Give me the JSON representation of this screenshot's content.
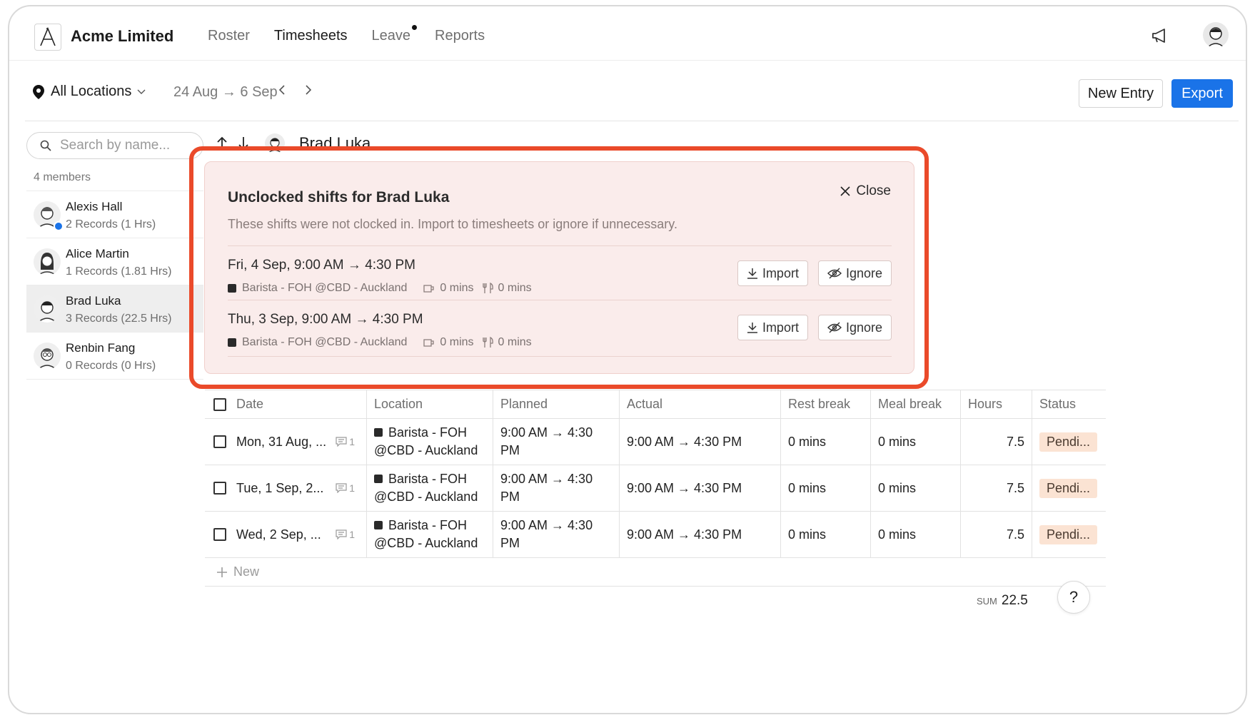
{
  "app": {
    "company": "Acme Limited",
    "nav": [
      {
        "label": "Roster"
      },
      {
        "label": "Timesheets"
      },
      {
        "label": "Leave"
      },
      {
        "label": "Reports"
      }
    ]
  },
  "toolbar": {
    "location_label": "All Locations",
    "date_range": "24 Aug → 6 Sep",
    "prev": "‹",
    "next": "›",
    "new_entry_label": "New Entry",
    "export_label": "Export"
  },
  "sidebar": {
    "search_placeholder": "Search by name...",
    "members_count": "4 members",
    "members": [
      {
        "name": "Alexis Hall",
        "records": "2 Records (1 Hrs)"
      },
      {
        "name": "Alice Martin",
        "records": "1 Records (1.81 Hrs)"
      },
      {
        "name": "Brad Luka",
        "records": "3 Records (22.5 Hrs)"
      },
      {
        "name": "Renbin Fang",
        "records": "0 Records (0 Hrs)"
      }
    ]
  },
  "employee": {
    "name": "Brad Luka"
  },
  "popup": {
    "title": "Unclocked shifts for Brad Luka",
    "subtitle": "These shifts were not clocked in. Import to timesheets or ignore if unnecessary.",
    "close_label": "Close",
    "shifts": [
      {
        "when": "Fri, 4 Sep, 9:00 AM → 4:30 PM",
        "location": "Barista - FOH @CBD - Auckland",
        "rest": "0 mins",
        "meal": "0 mins",
        "import_label": "Import",
        "ignore_label": "Ignore"
      },
      {
        "when": "Thu, 3 Sep, 9:00 AM → 4:30 PM",
        "location": "Barista - FOH @CBD - Auckland",
        "rest": "0 mins",
        "meal": "0 mins",
        "import_label": "Import",
        "ignore_label": "Ignore"
      }
    ]
  },
  "table": {
    "headers": {
      "date": "Date",
      "location": "Location",
      "planned": "Planned",
      "actual": "Actual",
      "rest": "Rest break",
      "meal": "Meal break",
      "hours": "Hours",
      "status": "Status"
    },
    "rows": [
      {
        "date": "Mon, 31 Aug, ...",
        "comments": "1",
        "loc1": "Barista - FOH",
        "loc2": "@CBD - Auckland",
        "plan1": "9:00 AM → 4:30",
        "plan2": "PM",
        "actual": "9:00 AM → 4:30 PM",
        "rest": "0 mins",
        "meal": "0 mins",
        "hours": "7.5",
        "status": "Pendi..."
      },
      {
        "date": "Tue, 1 Sep, 2...",
        "comments": "1",
        "loc1": "Barista - FOH",
        "loc2": "@CBD - Auckland",
        "plan1": "9:00 AM → 4:30",
        "plan2": "PM",
        "actual": "9:00 AM → 4:30 PM",
        "rest": "0 mins",
        "meal": "0 mins",
        "hours": "7.5",
        "status": "Pendi..."
      },
      {
        "date": "Wed, 2 Sep, ...",
        "comments": "1",
        "loc1": "Barista - FOH",
        "loc2": "@CBD - Auckland",
        "plan1": "9:00 AM → 4:30",
        "plan2": "PM",
        "actual": "9:00 AM → 4:30 PM",
        "rest": "0 mins",
        "meal": "0 mins",
        "hours": "7.5",
        "status": "Pendi..."
      }
    ],
    "new_label": "New",
    "sum_label": "SUM",
    "sum_value": "22.5"
  },
  "help_label": "?",
  "colors": {
    "accent": "#1a73e8",
    "highlight": "#ea4a2a",
    "popup_bg": "#faeceb",
    "status_bg": "#fbe3d3"
  }
}
